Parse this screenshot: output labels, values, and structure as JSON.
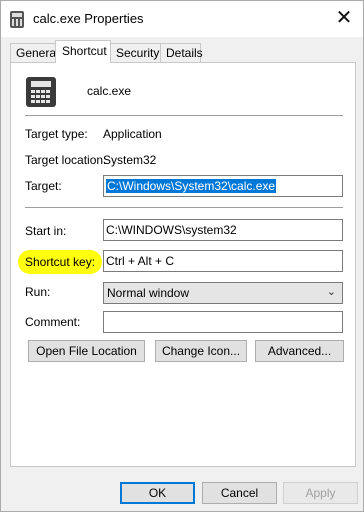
{
  "window": {
    "title": "calc.exe Properties",
    "close_glyph": "✕"
  },
  "tabs": [
    {
      "label": "General"
    },
    {
      "label": "Shortcut"
    },
    {
      "label": "Security"
    },
    {
      "label": "Details"
    }
  ],
  "shortcut": {
    "app_icon": "calculator-icon",
    "app_name": "calc.exe",
    "target_type_label": "Target type:",
    "target_type_value": "Application",
    "target_location_label": "Target location:",
    "target_location_value": "System32",
    "target_label": "Target:",
    "target_value": "C:\\Windows\\System32\\calc.exe",
    "start_in_label": "Start in:",
    "start_in_value": "C:\\WINDOWS\\system32",
    "shortcut_key_label": "Shortcut key:",
    "shortcut_key_value": "Ctrl + Alt + C",
    "run_label": "Run:",
    "run_value": "Normal window",
    "comment_label": "Comment:",
    "comment_value": "",
    "open_location_button": "Open File Location",
    "change_icon_button": "Change Icon...",
    "advanced_button": "Advanced..."
  },
  "footer": {
    "ok": "OK",
    "cancel": "Cancel",
    "apply": "Apply"
  },
  "colors": {
    "selection": "#0078d7",
    "highlight": "#ffff00"
  }
}
